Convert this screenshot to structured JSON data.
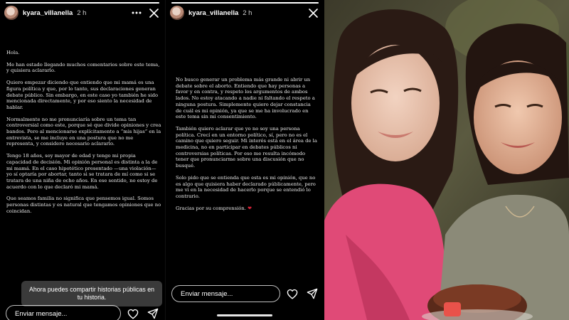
{
  "story_left": {
    "username": "kyara_villanella",
    "time": "2 h",
    "progress": 1.0,
    "paragraphs": [
      "Hola.",
      "Me han estado llegando muchos comentarios sobre este tema, y quisiera aclararlo.",
      "Quiero empezar diciendo que entiendo que mi mamá es una figura política y que, por lo tanto, sus declaraciones generan debate público. Sin embargo, en este caso yo también he sido mencionada directamente, y por eso siento la necesidad de hablar.",
      "Normalmente no me pronunciaría sobre un tema tan controversial como este, porque sé que divide opiniones y crea bandos. Pero al mencionarse explícitamente a “mis hijas” en la entrevista, se me incluye en una postura que no me representa, y considero necesario aclararlo.",
      "Tengo 18 años, soy mayor de edad y tengo mi propia capacidad de decisión. Mi opinión personal es distinta a la de mi mamá. En el caso hipotético presentado —una violación— yo sí optaría por abortar, tanto si se tratara de mí como si se tratara de una niña de ocho años. En ese sentido, no estoy de acuerdo con lo que declaró mi mamá.",
      "Que seamos familia no significa que pensemos igual. Somos personas distintas y es natural que tengamos opiniones que no coincidan."
    ],
    "toast": "Ahora puedes compartir historias públicas en tu historia.",
    "message_placeholder": "Enviar mensaje..."
  },
  "story_right": {
    "username": "kyara_villanella",
    "time": "2 h",
    "progress": 1.0,
    "paragraphs": [
      "No busco generar un problema más grande ni abrir un debate sobre el aborto. Entiendo que hay personas a favor y en contra, y respeto los argumentos de ambos lados. No estoy atacando a nadie ni faltando el respeto a ninguna postura. Simplemente quiero dejar constancia de cuál es mi opinión, ya que se me ha involucrado en este tema sin mi consentimiento.",
      "También quiero aclarar que yo no soy una persona política. Crecí en un entorno político, sí, pero no es el camino que quiero seguir. Mi interés está en el área de la medicina, no en participar en debates públicos ni controversias políticas. Por eso me resulta incómodo tener que pronunciarme sobre una discusión que no busqué.",
      "Solo pido que se entienda que esta es mi opinión, que no es algo que quisiera haber declarado públicamente, pero me vi en la necesidad de hacerlo porque se entendió lo contrario."
    ],
    "closing_text": "Gracias por su comprensión. ",
    "closing_emoji": "❤",
    "message_placeholder": "Enviar mensaje..."
  },
  "icons": {
    "more": "more-horizontal-icon",
    "close": "close-icon",
    "like": "heart-icon",
    "share": "send-icon"
  },
  "colors": {
    "background": "#000000",
    "toast": "#3a3a3a",
    "emoji_heart": "#e0243a"
  }
}
